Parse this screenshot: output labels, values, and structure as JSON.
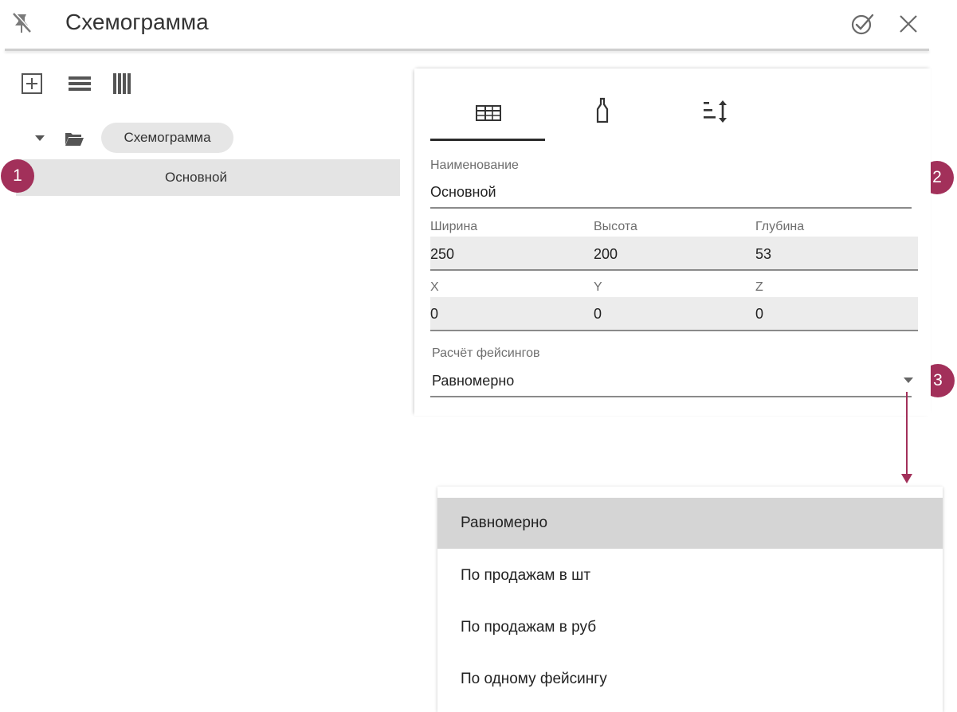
{
  "header": {
    "title": "Схемограмма",
    "icons": {
      "pin": "pin-off-icon",
      "confirm": "check-circle-icon",
      "close": "close-icon"
    }
  },
  "toolbar": {
    "icons": [
      "add-box-icon",
      "list-rows-icon",
      "list-columns-icon"
    ]
  },
  "tree": {
    "root": {
      "label": "Схемограмма",
      "expanded": true,
      "icon": "folder-open-icon"
    },
    "children": [
      {
        "label": "Основной",
        "selected": true
      }
    ]
  },
  "badges": [
    "1",
    "2",
    "3"
  ],
  "tabs": [
    {
      "icon": "grid-icon",
      "active": true
    },
    {
      "icon": "bottle-icon",
      "active": false
    },
    {
      "icon": "sort-height-icon",
      "active": false
    }
  ],
  "form": {
    "name": {
      "label": "Наименование",
      "value": "Основной"
    },
    "width": {
      "label": "Ширина",
      "value": "250"
    },
    "height": {
      "label": "Высота",
      "value": "200"
    },
    "depth": {
      "label": "Глубина",
      "value": "53"
    },
    "x": {
      "label": "X",
      "value": "0"
    },
    "y": {
      "label": "Y",
      "value": "0"
    },
    "z": {
      "label": "Z",
      "value": "0"
    },
    "facing": {
      "label": "Расчёт фейсингов",
      "value": "Равномерно"
    }
  },
  "dropdown": {
    "options": [
      "Равномерно",
      "По продажам в шт",
      "По продажам в руб",
      "По одному фейсингу"
    ],
    "selected_index": 0
  },
  "colors": {
    "badge": "#a2305a",
    "selected_row": "#e4e4e4",
    "selected_option": "#d5d5d5"
  }
}
